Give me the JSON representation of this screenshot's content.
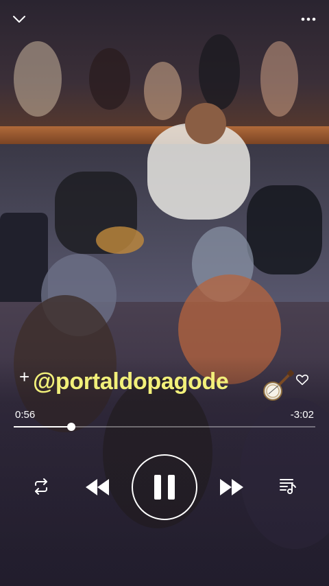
{
  "top_bar": {
    "collapse_icon": "chevron-down-icon",
    "more_icon": "more-dots-icon"
  },
  "track": {
    "add_symbol": "+",
    "title": "@portaldopagode",
    "emoji_icon": "banjo-icon",
    "like_icon": "heart-outline-icon"
  },
  "player": {
    "elapsed": "0:56",
    "remaining": "-3:02",
    "progress_fraction": 0.19,
    "repeat_icon": "repeat-icon",
    "previous_icon": "rewind-icon",
    "play_pause_icon": "pause-icon",
    "next_icon": "fast-forward-icon",
    "queue_icon": "music-queue-icon"
  },
  "colors": {
    "title": "#f2f07a",
    "icons": "#ffffff"
  }
}
